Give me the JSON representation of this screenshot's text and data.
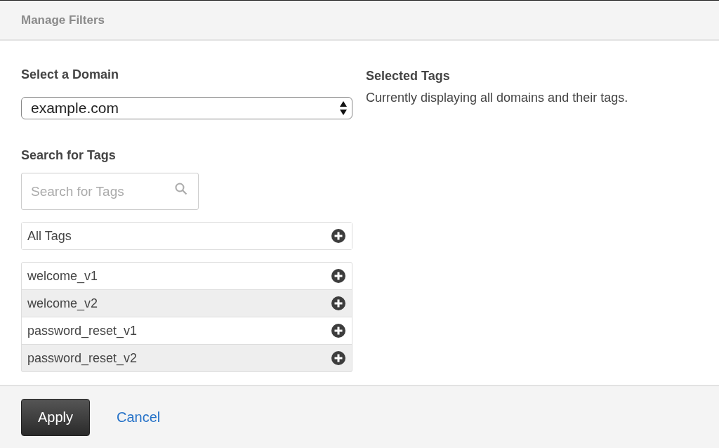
{
  "dialog": {
    "title": "Manage Filters"
  },
  "domain": {
    "label": "Select a Domain",
    "value": "example.com"
  },
  "search": {
    "label": "Search for Tags",
    "placeholder": "Search for Tags"
  },
  "all_tags": {
    "label": "All Tags"
  },
  "tags": [
    {
      "name": "welcome_v1"
    },
    {
      "name": "welcome_v2"
    },
    {
      "name": "password_reset_v1"
    },
    {
      "name": "password_reset_v2"
    }
  ],
  "selected_tags": {
    "title": "Selected Tags",
    "message": "Currently displaying all domains and their tags."
  },
  "buttons": {
    "apply": "Apply",
    "cancel": "Cancel"
  }
}
